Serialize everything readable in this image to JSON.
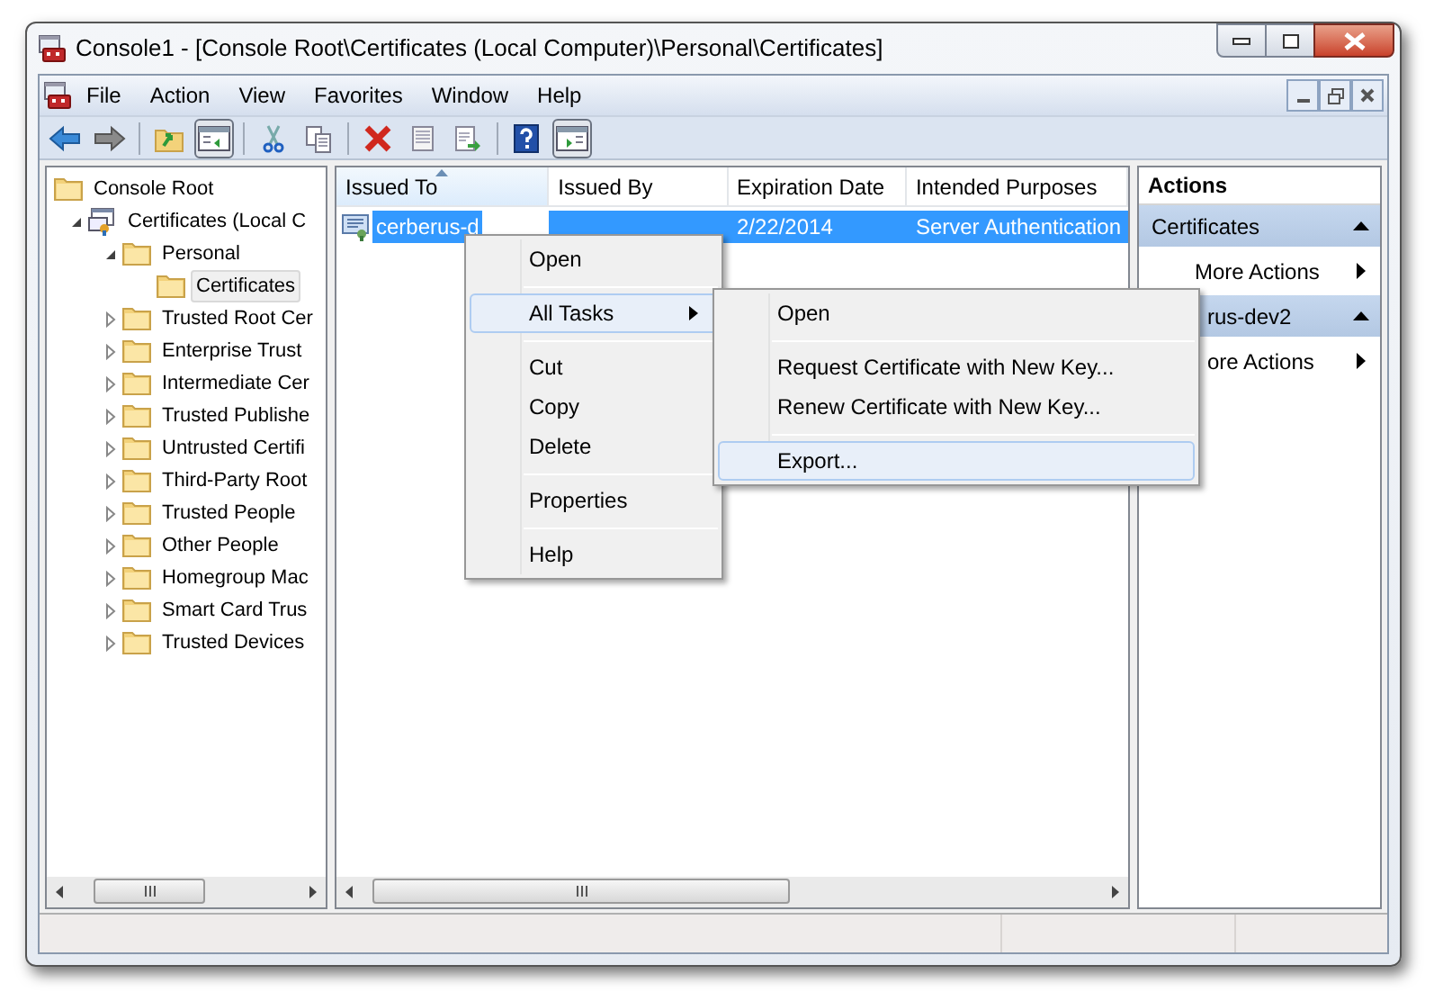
{
  "window": {
    "title": "Console1 - [Console Root\\Certificates (Local Computer)\\Personal\\Certificates]"
  },
  "menu_bar": [
    "File",
    "Action",
    "View",
    "Favorites",
    "Window",
    "Help"
  ],
  "toolbar": [
    {
      "kind": "back",
      "pressed": false
    },
    {
      "kind": "forward",
      "pressed": false
    },
    {
      "kind": "separator"
    },
    {
      "kind": "up",
      "pressed": false
    },
    {
      "kind": "tree",
      "pressed": true
    },
    {
      "kind": "separator"
    },
    {
      "kind": "cut",
      "pressed": false
    },
    {
      "kind": "copy",
      "pressed": false
    },
    {
      "kind": "separator"
    },
    {
      "kind": "delete",
      "pressed": false
    },
    {
      "kind": "properties",
      "pressed": false
    },
    {
      "kind": "export",
      "pressed": false
    },
    {
      "kind": "separator"
    },
    {
      "kind": "help",
      "pressed": false
    },
    {
      "kind": "actionpane",
      "pressed": true
    }
  ],
  "tree": [
    {
      "label": "Console Root",
      "kind": "folder",
      "selected": false,
      "children": [
        {
          "label": "Certificates (Local C",
          "kind": "store",
          "expanded": true,
          "selected": false,
          "children": [
            {
              "label": "Personal",
              "kind": "folder",
              "expanded": true,
              "selected": false,
              "children": [
                {
                  "label": "Certificates",
                  "kind": "folder",
                  "selected": true
                }
              ]
            },
            {
              "label": "Trusted Root Cer",
              "kind": "folder",
              "expanded": false,
              "selected": false
            },
            {
              "label": "Enterprise Trust",
              "kind": "folder",
              "expanded": false,
              "selected": false
            },
            {
              "label": "Intermediate Cer",
              "kind": "folder",
              "expanded": false,
              "selected": false
            },
            {
              "label": "Trusted Publishe",
              "kind": "folder",
              "expanded": false,
              "selected": false
            },
            {
              "label": "Untrusted Certifi",
              "kind": "folder",
              "expanded": false,
              "selected": false
            },
            {
              "label": "Third-Party Root",
              "kind": "folder",
              "expanded": false,
              "selected": false
            },
            {
              "label": "Trusted People",
              "kind": "folder",
              "expanded": false,
              "selected": false
            },
            {
              "label": "Other People",
              "kind": "folder",
              "expanded": false,
              "selected": false
            },
            {
              "label": "Homegroup Mac",
              "kind": "folder",
              "expanded": false,
              "selected": false
            },
            {
              "label": "Smart Card Trus",
              "kind": "folder",
              "expanded": false,
              "selected": false
            },
            {
              "label": "Trusted Devices",
              "kind": "folder",
              "expanded": false,
              "selected": false
            }
          ]
        }
      ]
    }
  ],
  "table": {
    "columns": [
      {
        "label": "Issued To",
        "sorted": true
      },
      {
        "label": "Issued By",
        "sorted": false
      },
      {
        "label": "Expiration Date",
        "sorted": false
      },
      {
        "label": "Intended Purposes",
        "sorted": false
      }
    ],
    "rows": [
      {
        "issued_to": "cerberus-d",
        "expiration_date": "2/22/2014",
        "intended_purposes": "Server Authentication",
        "selected": true
      }
    ]
  },
  "actions": {
    "title": "Actions",
    "sections": [
      {
        "header": "Certificates",
        "items": [
          "More Actions"
        ]
      },
      {
        "header": "rus-dev2",
        "items": [
          "ore Actions"
        ]
      }
    ]
  },
  "context_menu": [
    {
      "kind": "item",
      "label": "Open",
      "selected": false
    },
    {
      "kind": "separator"
    },
    {
      "kind": "submenu",
      "label": "All Tasks",
      "selected": true
    },
    {
      "kind": "separator"
    },
    {
      "kind": "item",
      "label": "Cut",
      "selected": false
    },
    {
      "kind": "item",
      "label": "Copy",
      "selected": false
    },
    {
      "kind": "item",
      "label": "Delete",
      "selected": false
    },
    {
      "kind": "separator"
    },
    {
      "kind": "item",
      "label": "Properties",
      "selected": false
    },
    {
      "kind": "separator"
    },
    {
      "kind": "item",
      "label": "Help",
      "selected": false
    }
  ],
  "submenu": [
    {
      "kind": "item",
      "label": "Open",
      "selected": false
    },
    {
      "kind": "separator"
    },
    {
      "kind": "item",
      "label": "Request Certificate with New Key...",
      "selected": false
    },
    {
      "kind": "item",
      "label": "Renew Certificate with New Key...",
      "selected": false
    },
    {
      "kind": "separator"
    },
    {
      "kind": "item",
      "label": "Export...",
      "selected": true
    }
  ]
}
